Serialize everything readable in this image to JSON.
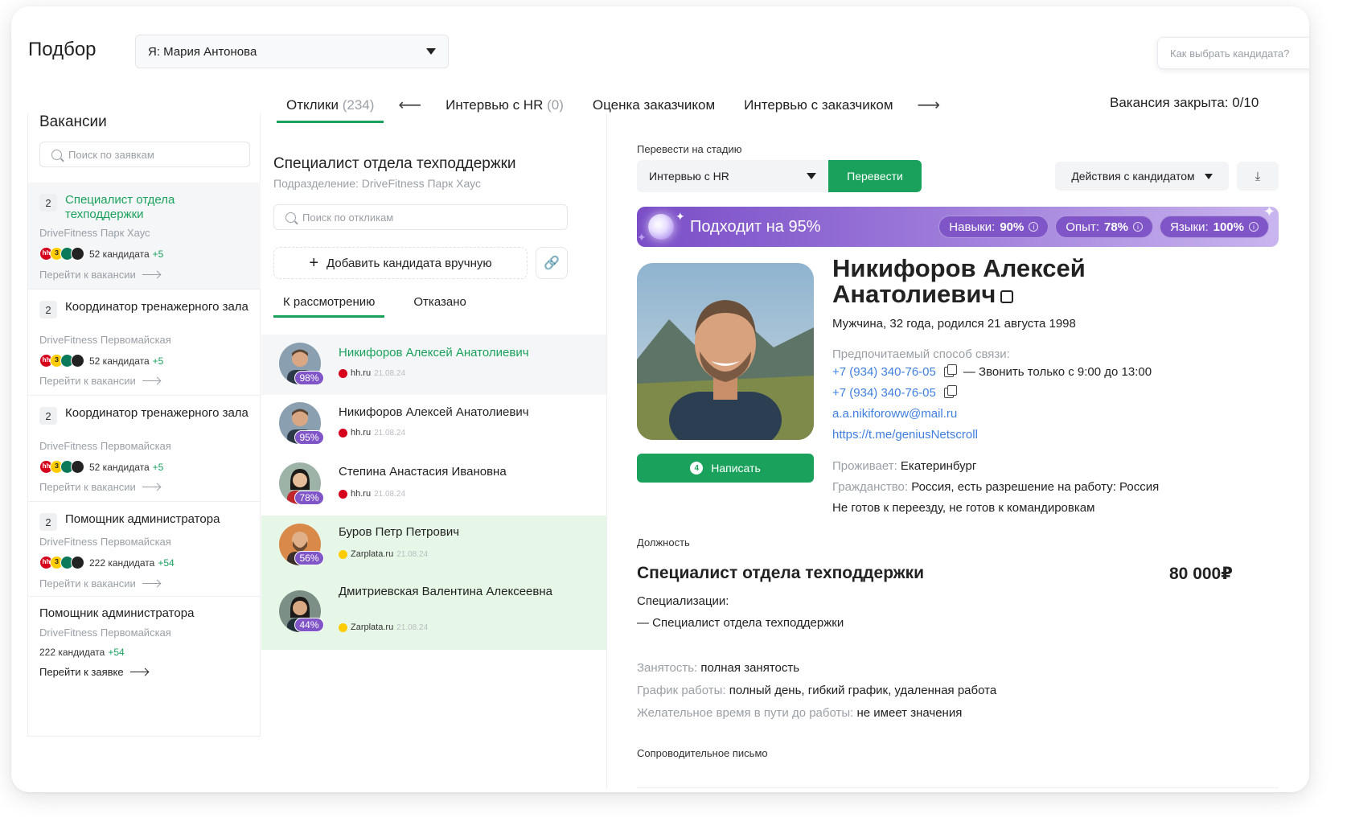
{
  "header": {
    "title": "Подбор",
    "user_select": "Я: Мария Антонова",
    "help_placeholder": "Как выбрать кандидата?"
  },
  "stages": {
    "tabs": [
      {
        "label": "Отклики",
        "count": "(234)"
      },
      {
        "label": "Интервью с HR",
        "count": "(0)"
      },
      {
        "label": "Оценка заказчиком",
        "count": ""
      },
      {
        "label": "Интервью с заказчиком",
        "count": ""
      }
    ],
    "arrow_left": "⟵",
    "arrow_right": "⟶",
    "closed_label": "Вакансия закрыта:",
    "closed_value": "0/10"
  },
  "vacancies": {
    "title": "Вакансии",
    "search_placeholder": "Поиск по заявкам",
    "items": [
      {
        "count": "2",
        "title": "Специалист отдела техподдержки",
        "location": "DriveFitness Парк Хаус",
        "candidates": "52 кандидата",
        "delta": "+5",
        "link": "Перейти к вакансии"
      },
      {
        "count": "2",
        "title": "Координатор тренажерного зала",
        "location": "DriveFitness Первомайская",
        "candidates": "52 кандидата",
        "delta": "+5",
        "link": "Перейти к вакансии"
      },
      {
        "count": "2",
        "title": "Координатор тренажерного зала",
        "location": "DriveFitness Первомайская",
        "candidates": "52 кандидата",
        "delta": "+5",
        "link": "Перейти к вакансии"
      },
      {
        "count": "2",
        "title": "Помощник администратора",
        "location": "DriveFitness Первомайская",
        "candidates": "222 кандидата",
        "delta": "+54",
        "link": "Перейти к вакансии"
      },
      {
        "count": "",
        "title": "Помощник администратора",
        "location": "DriveFitness Первомайская",
        "candidates": "222 кандидата",
        "delta": "+54",
        "link": "Перейти к заявке"
      }
    ]
  },
  "responses": {
    "title": "Специалист отдела техподдержки",
    "subtitle": "Подразделение: DriveFitness Парк Хаус",
    "search_placeholder": "Поиск по откликам",
    "add_label": "Добавить кандидата вручную",
    "tabs": [
      "К рассмотрению",
      "Отказано"
    ],
    "candidates": [
      {
        "name": "Никифоров Алексей Анатолиевич",
        "pct": "98%",
        "source": "hh.ru",
        "date": "21.08.24"
      },
      {
        "name": "Никифоров Алексей Анатолиевич",
        "pct": "95%",
        "source": "hh.ru",
        "date": "21.08.24"
      },
      {
        "name": "Степина Анастасия Ивановна",
        "pct": "78%",
        "source": "hh.ru",
        "date": "21.08.24"
      },
      {
        "name": "Буров Петр Петрович",
        "pct": "56%",
        "source": "Zarplata.ru",
        "date": "21.08.24"
      },
      {
        "name": "Дмитриевская Валентина Алексеевна",
        "pct": "44%",
        "source": "Zarplata.ru",
        "date": "21.08.24"
      }
    ]
  },
  "detail": {
    "stage_label": "Перевести на стадию",
    "stage_value": "Интервью с HR",
    "move_button": "Перевести",
    "actions_button": "Действия с кандидатом",
    "match": {
      "title": "Подходит на 95%",
      "pills": [
        {
          "label": "Навыки:",
          "value": "90%"
        },
        {
          "label": "Опыт:",
          "value": "78%"
        },
        {
          "label": "Языки:",
          "value": "100%"
        }
      ]
    },
    "write_button": "Написать",
    "write_badge": "4",
    "name": "Никифоров Алексей Анатолиевич",
    "demographics": "Мужчина, 32 года, родился 21 августа 1998",
    "contact_label": "Предпочитаемый способ  связи:",
    "phone1": "+7 (934) 340-76-05",
    "phone1_note": "— Звонить только с 9:00 до 13:00",
    "phone2": "+7 (934) 340-76-05",
    "email": "a.a.nikiforoww@mail.ru",
    "telegram": "https://t.me/geniusNetscroll",
    "residence_label": "Проживает:",
    "residence": "Екатеринбург",
    "citizenship_label": "Гражданство:",
    "citizenship": "Россия, есть разрешение на работу: Россия",
    "relocation": "Не готов к переезду, не готов к командировкам",
    "position_label": "Должность",
    "position": "Специалист отдела техподдержки",
    "salary": "80 000₽",
    "spec_label": "Специализации:",
    "spec_value": "— Специалист отдела техподдержки",
    "employment_label": "Занятость:",
    "employment": "полная занятость",
    "schedule_label": "График работы:",
    "schedule": "полный день, гибкий график, удаленная работа",
    "commute_label": "Желательное время в пути до работы:",
    "commute": "не имеет значения",
    "cover_label": "Сопроводительное письмо"
  },
  "colors": {
    "accent": "#1aa25c",
    "match_purple": "#7f55c7",
    "highlight_row": "#e6f7e7"
  }
}
